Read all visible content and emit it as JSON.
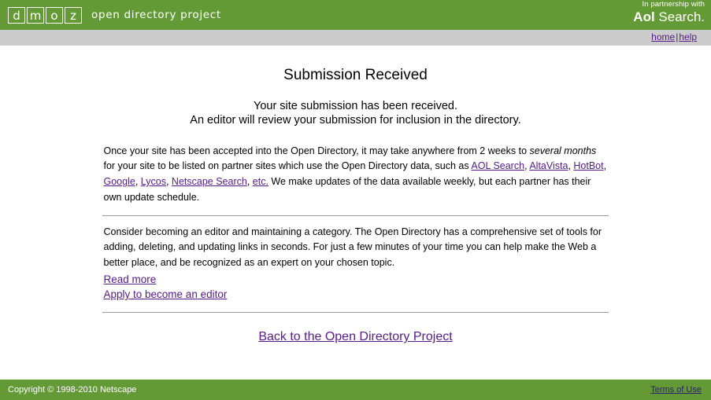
{
  "header": {
    "logo_letters": [
      "d",
      "m",
      "o",
      "z"
    ],
    "logo_tagline": "open directory project",
    "partner_line": "In partnership with",
    "partner_brand_bold": "Aol",
    "partner_brand_rest": " Search.",
    "green": "#649a35"
  },
  "navbar": {
    "home_label": "home",
    "separator": "|",
    "help_label": "help",
    "background": "#cccccc"
  },
  "main": {
    "title": "Submission Received",
    "intro_line1": "Your site submission has been received.",
    "intro_line2": "An editor will review your submission for inclusion in the directory.",
    "paragraph1": {
      "part1": "Once your site has been accepted into the Open Directory, it may take anywhere from 2 weeks to ",
      "italic": "several months",
      "part2": " for your site to be listed on partner sites which use the Open Directory data, such as ",
      "links": [
        {
          "label": "AOL Search",
          "after": ", "
        },
        {
          "label": "AltaVista",
          "after": ", "
        },
        {
          "label": "HotBot",
          "after": ", "
        },
        {
          "label": "Google",
          "after": ", "
        },
        {
          "label": "Lycos",
          "after": ", "
        },
        {
          "label": "Netscape Search",
          "after": ", "
        },
        {
          "label": "etc.",
          "after": " "
        }
      ],
      "part3": "We make updates of the data available weekly, but each partner has their own update schedule."
    },
    "paragraph2": "Consider becoming an editor and maintaining a category. The Open Directory has a comprehensive set of tools for adding, deleting, and updating links in seconds. For just a few minutes of your time you can help make the Web a better place, and be recognized as an expert on your chosen topic.",
    "editor_links": [
      {
        "label": "Read more"
      },
      {
        "label": "Apply to become an editor"
      }
    ],
    "back_link": "Back to the Open Directory Project",
    "link_color": "#551a8b"
  },
  "footer": {
    "copyright": "Copyright © 1998-2010 Netscape",
    "terms_label": "Terms of Use",
    "green": "#649a35"
  }
}
